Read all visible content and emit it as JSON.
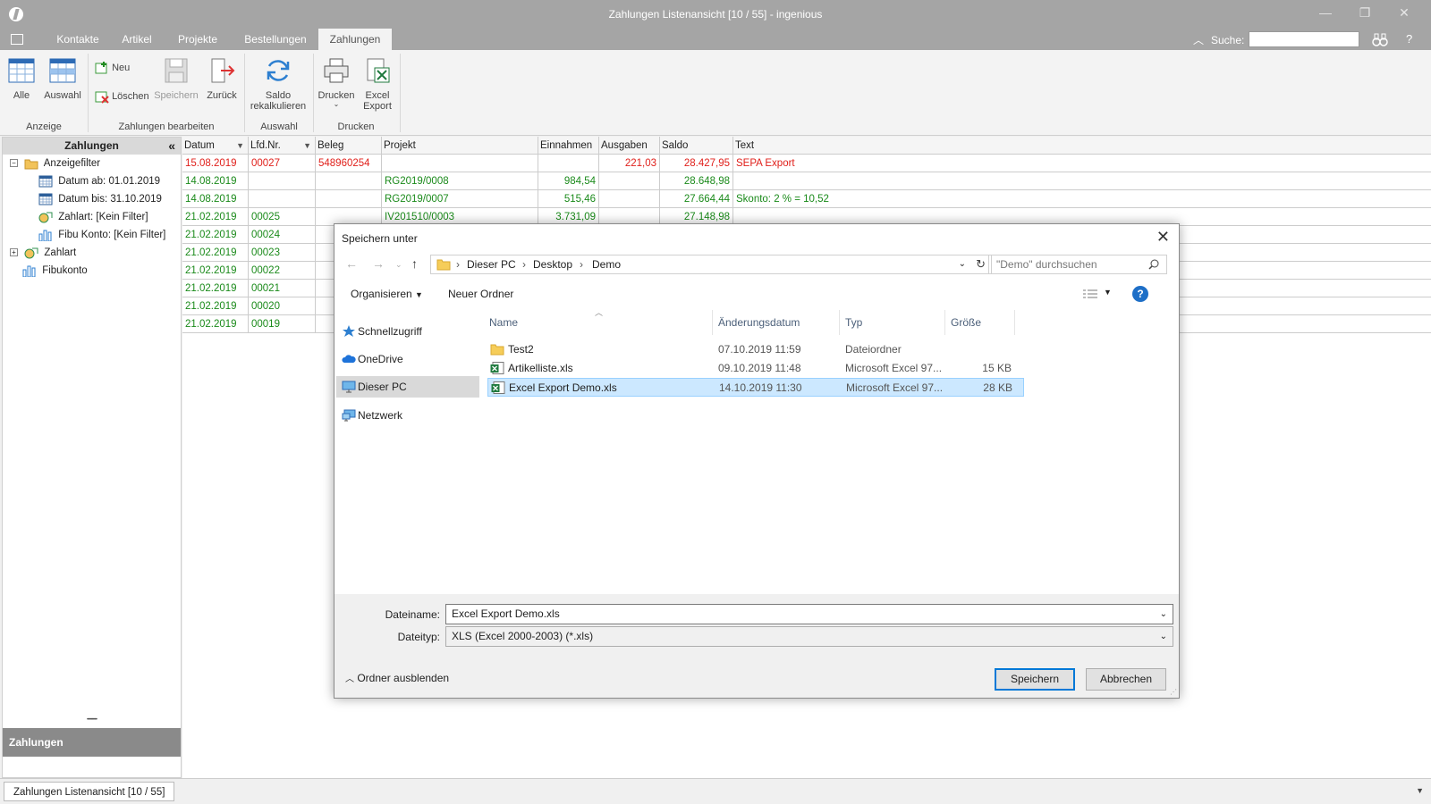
{
  "window": {
    "title": "Zahlungen Listenansicht [10 / 55] - ingenious",
    "minimize": "—",
    "restore": "❐",
    "close": "✕",
    "colors": {
      "titlebar": "#a5a5a5",
      "ribbon": "#f3f3f3",
      "accent": "#0078d7",
      "red_row": "#e0201b",
      "green_row": "#1a8a1a"
    }
  },
  "menubar": {
    "tabs": [
      "Kontakte",
      "Artikel",
      "Projekte",
      "Bestellungen",
      "Zahlungen"
    ],
    "active_tab": "Zahlungen",
    "search_label": "Suche:",
    "search_value": "",
    "collapse_glyph": "︿",
    "help": "?"
  },
  "ribbon": {
    "groups": [
      {
        "label": "Anzeige",
        "buttons": [
          "Alle",
          "Auswahl"
        ]
      },
      {
        "label": "Zahlungen bearbeiten",
        "buttons": [
          "Neu",
          "Löschen",
          "Speichern",
          "Zurück"
        ]
      },
      {
        "label": "Auswahl",
        "buttons": [
          "Saldo rekalkulieren"
        ]
      },
      {
        "label": "Drucken",
        "buttons": [
          "Drucken",
          "Excel Export"
        ]
      }
    ],
    "saldo_line1": "Saldo",
    "saldo_line2": "rekalkulieren",
    "excel_line1": "Excel",
    "excel_line2": "Export"
  },
  "sidebar": {
    "title": "Zahlungen",
    "collapse_glyph": "«",
    "tree": [
      {
        "label": "Anzeigefilter",
        "level": 0,
        "expand": "−"
      },
      {
        "label": "Datum ab: 01.01.2019",
        "level": 1
      },
      {
        "label": "Datum bis: 31.10.2019",
        "level": 1
      },
      {
        "label": "Zahlart: [Kein Filter]",
        "level": 1
      },
      {
        "label": "Fibu Konto: [Kein Filter]",
        "level": 1
      },
      {
        "label": "Zahlart",
        "level": 0,
        "expand": "+"
      },
      {
        "label": "Fibukonto",
        "level": 0
      }
    ],
    "bottom_label": "Zahlungen",
    "grip": "••••••••••"
  },
  "grid": {
    "columns": [
      "Datum",
      "Lfd.Nr.",
      "Beleg",
      "Projekt",
      "Einnahmen",
      "Ausgaben",
      "Saldo",
      "Text"
    ],
    "rows": [
      {
        "status": "red",
        "cells": [
          "15.08.2019",
          "00027",
          "548960254",
          "",
          "",
          "221,03",
          "28.427,95",
          "SEPA Export"
        ]
      },
      {
        "status": "green",
        "cells": [
          "14.08.2019",
          "",
          "",
          "RG2019/0008",
          "984,54",
          "",
          "28.648,98",
          ""
        ]
      },
      {
        "status": "green",
        "cells": [
          "14.08.2019",
          "",
          "",
          "RG2019/0007",
          "515,46",
          "",
          "27.664,44",
          "Skonto: 2 % = 10,52"
        ]
      },
      {
        "status": "green",
        "cells": [
          "21.02.2019",
          "00025",
          "",
          "IV201510/0003",
          "3.731,09",
          "",
          "27.148,98",
          ""
        ]
      },
      {
        "status": "green",
        "cells": [
          "21.02.2019",
          "00024",
          "",
          "",
          "",
          "",
          "",
          ""
        ]
      },
      {
        "status": "green",
        "cells": [
          "21.02.2019",
          "00023",
          "",
          "",
          "",
          "",
          "",
          ""
        ]
      },
      {
        "status": "green",
        "cells": [
          "21.02.2019",
          "00022",
          "",
          "",
          "",
          "",
          "",
          ""
        ]
      },
      {
        "status": "green",
        "cells": [
          "21.02.2019",
          "00021",
          "",
          "",
          "",
          "",
          "",
          ""
        ]
      },
      {
        "status": "green",
        "cells": [
          "21.02.2019",
          "00020",
          "",
          "",
          "",
          "",
          "",
          ""
        ]
      },
      {
        "status": "green",
        "cells": [
          "21.02.2019",
          "00019",
          "",
          "",
          "",
          "",
          "",
          ""
        ]
      }
    ]
  },
  "statusbar": {
    "tab_label": "Zahlungen Listenansicht [10 / 55]"
  },
  "dialog": {
    "title": "Speichern unter",
    "close": "✕",
    "breadcrumb": [
      "Dieser PC",
      "Desktop",
      "Demo"
    ],
    "search_placeholder": "\"Demo\" durchsuchen",
    "organize": "Organisieren",
    "new_folder": "Neuer Ordner",
    "help": "?",
    "nav_items": [
      "Schnellzugriff",
      "OneDrive",
      "Dieser PC",
      "Netzwerk"
    ],
    "selected_nav": "Dieser PC",
    "file_columns": [
      "Name",
      "Änderungsdatum",
      "Typ",
      "Größe"
    ],
    "files": [
      {
        "name": "Test2",
        "date": "07.10.2019 11:59",
        "type": "Dateiordner",
        "size": "",
        "kind": "folder"
      },
      {
        "name": "Artikelliste.xls",
        "date": "09.10.2019 11:48",
        "type": "Microsoft Excel 97...",
        "size": "15 KB",
        "kind": "excel"
      },
      {
        "name": "Excel Export Demo.xls",
        "date": "14.10.2019 11:30",
        "type": "Microsoft Excel 97...",
        "size": "28 KB",
        "kind": "excel",
        "selected": true
      }
    ],
    "filename_label": "Dateiname:",
    "filename_value": "Excel Export Demo.xls",
    "filetype_label": "Dateityp:",
    "filetype_value": "XLS (Excel 2000-2003) (*.xls)",
    "hide_folders": "Ordner ausblenden",
    "save_button": "Speichern",
    "cancel_button": "Abbrechen"
  }
}
